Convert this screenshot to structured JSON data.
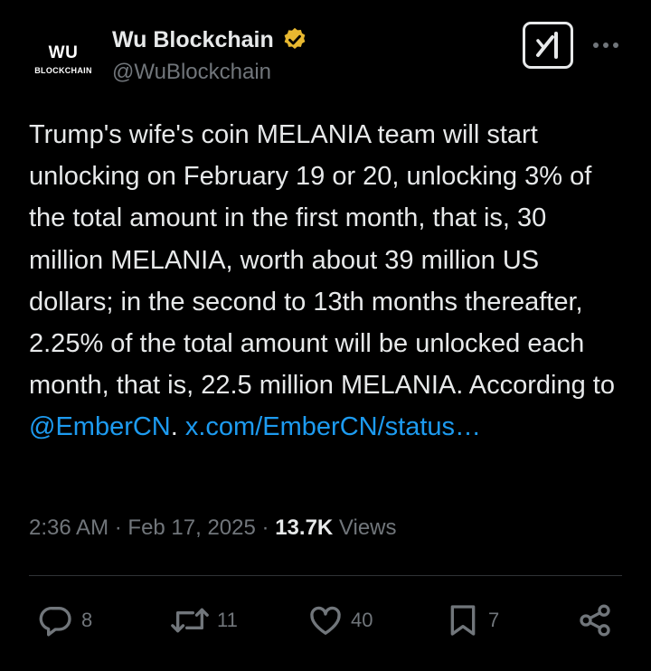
{
  "author": {
    "avatar_line1": "WU",
    "avatar_line2": "BLOCKCHAIN",
    "display_name": "Wu Blockchain",
    "handle": "@WuBlockchain",
    "verified_color": "#e8b830"
  },
  "tweet": {
    "body": "Trump's wife's coin MELANIA team will start unlocking on February 19 or 20, unlocking 3% of the total amount in the first month, that is, 30 million MELANIA, worth about 39 million US dollars; in the second to 13th months thereafter, 2.25% of the total amount will be unlocked each month, that is, 22.5 million MELANIA. According to",
    "mention": "@EmberCN",
    "after_mention": ".",
    "link": "x.com/EmberCN/status…"
  },
  "meta": {
    "time": "2:36 AM",
    "separator": "·",
    "date": "Feb 17, 2025",
    "views_count": "13.7K",
    "views_label": "Views"
  },
  "actions": {
    "replies": "8",
    "reposts": "11",
    "likes": "40",
    "bookmarks": "7"
  },
  "icons": [
    "grok-icon",
    "more-icon",
    "reply-icon",
    "repost-icon",
    "like-icon",
    "bookmark-icon",
    "share-icon",
    "verified-badge-icon"
  ],
  "colors": {
    "background": "#000000",
    "text": "#e7e9ea",
    "secondary": "#71767b",
    "link": "#1d9bf0",
    "divider": "#2f3336"
  }
}
